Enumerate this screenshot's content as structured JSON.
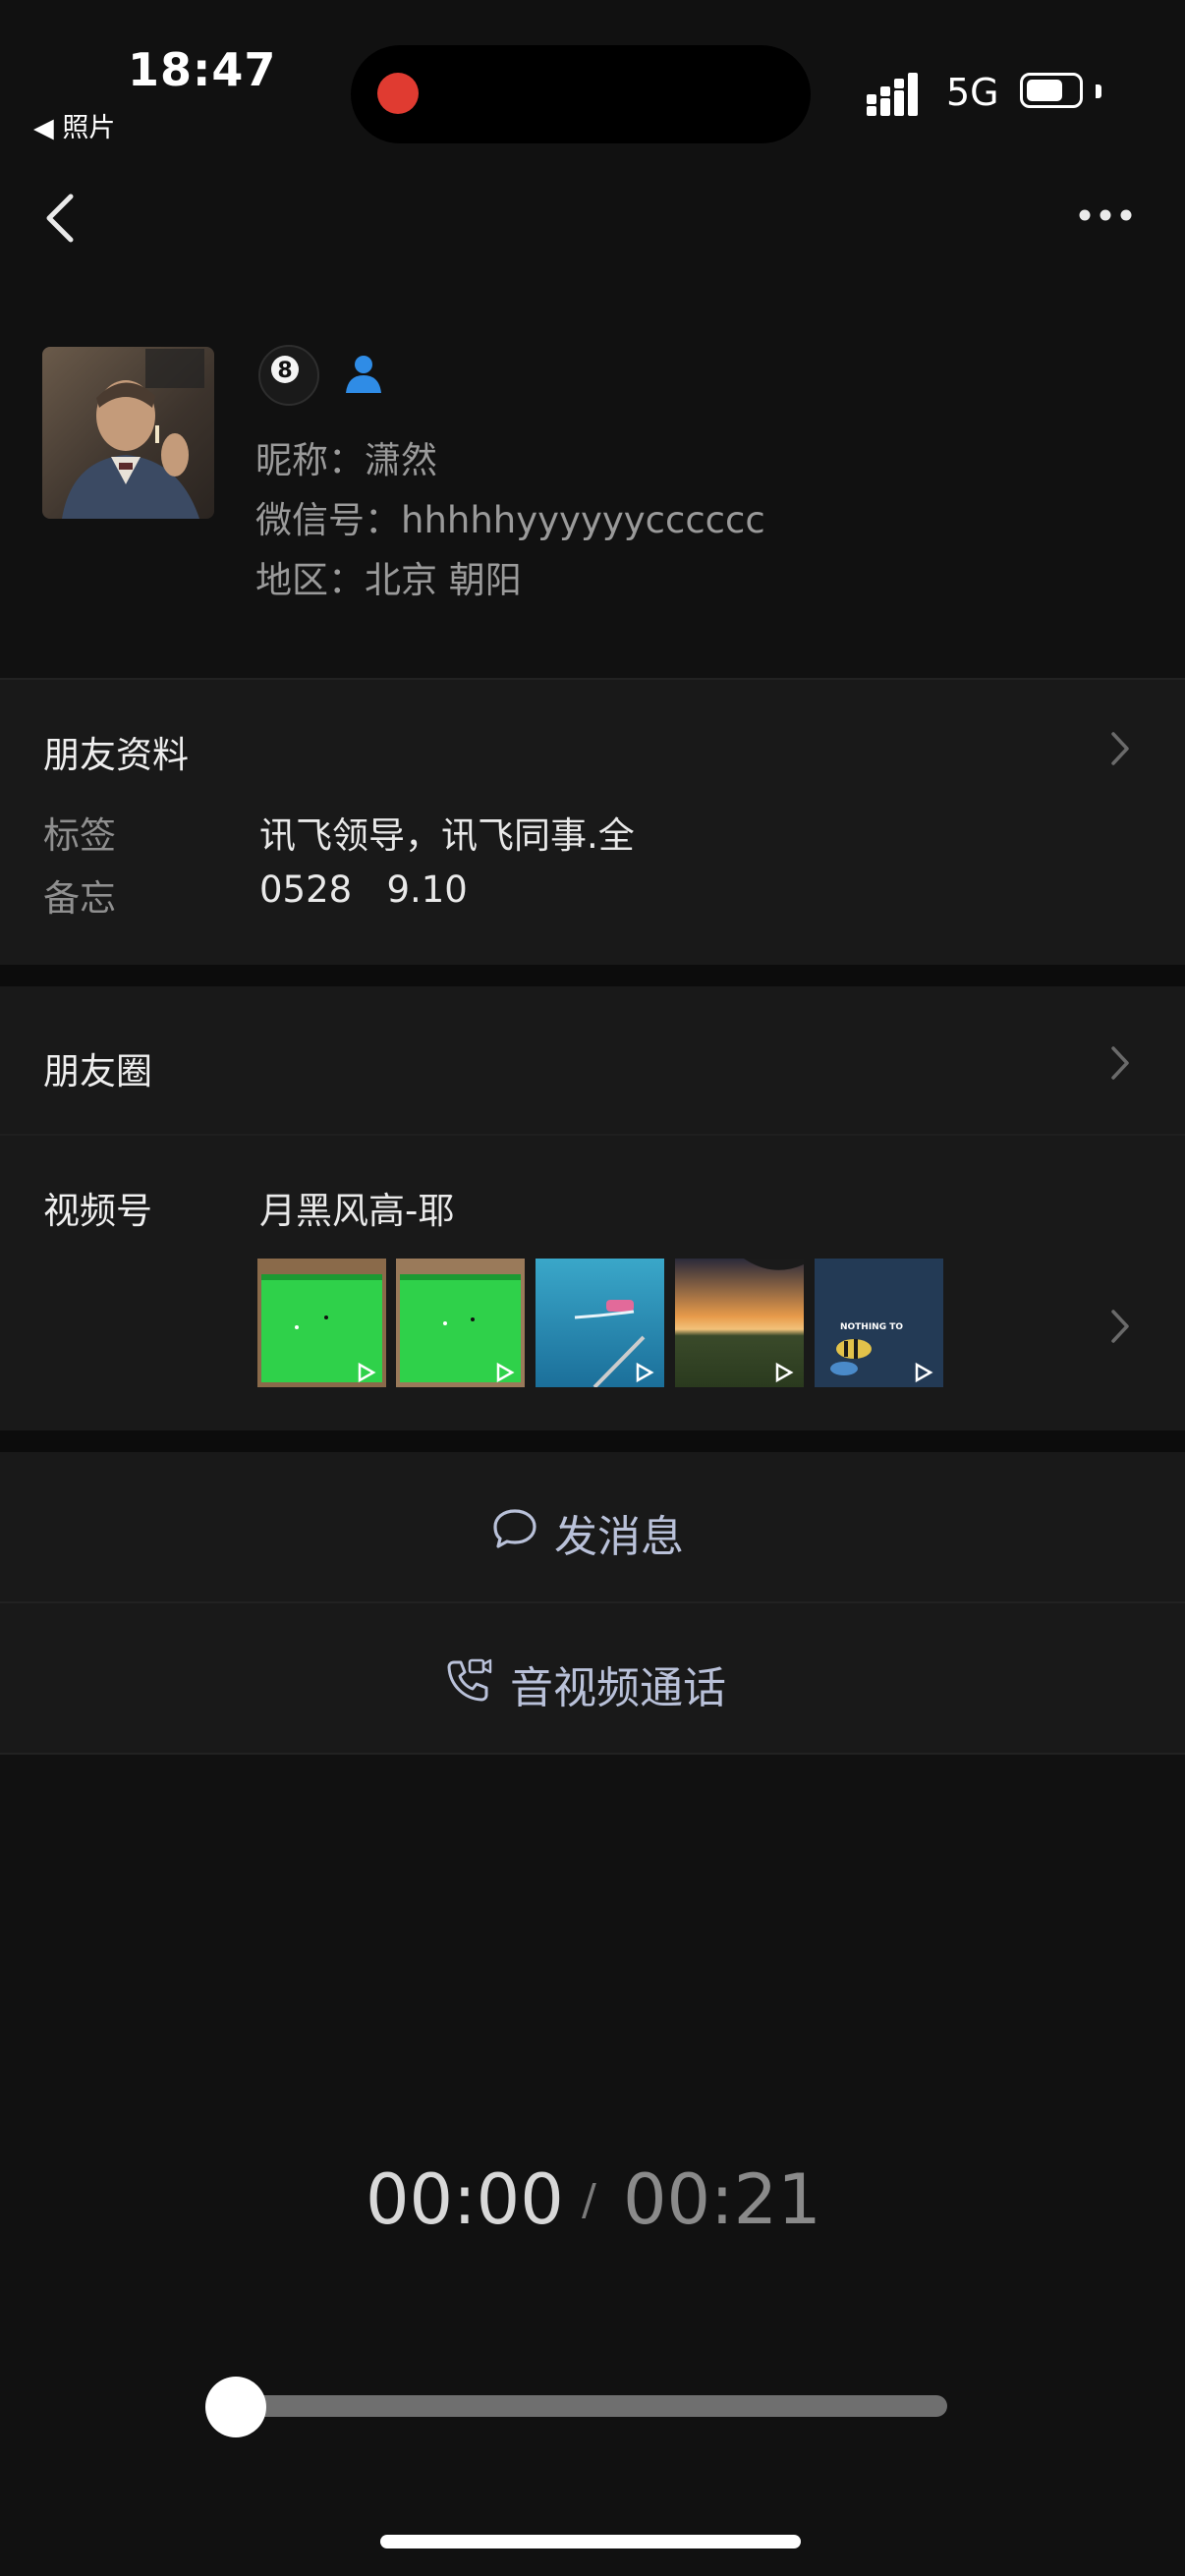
{
  "status_bar": {
    "time": "18:47",
    "back_app": "照片",
    "network": "5G"
  },
  "nav": {
    "back_icon": "chevron-left-icon",
    "more_icon": "more-dots-icon"
  },
  "profile": {
    "nickname": "昵称：潇然",
    "wechat_id": "微信号：hhhhhyyyyyycccccc",
    "region": "地区：北京 朝阳"
  },
  "friend_info": {
    "title": "朋友资料",
    "tags_label": "标签",
    "tags_value": "讯飞领导，讯飞同事.全",
    "remark_label": "备忘",
    "remark_value": "0528   9.10"
  },
  "moments": {
    "title": "朋友圈"
  },
  "channels": {
    "title": "视频号",
    "name": "月黑风高-耶",
    "thumbs": [
      {
        "name": "thumb-snooker-1",
        "kind": "green"
      },
      {
        "name": "thumb-snooker-2",
        "kind": "green"
      },
      {
        "name": "thumb-boat",
        "kind": "sea"
      },
      {
        "name": "thumb-sunset",
        "kind": "sunset"
      },
      {
        "name": "thumb-fish",
        "kind": "fish",
        "caption": "NOTHING TO"
      }
    ]
  },
  "actions": {
    "message": "发消息",
    "call": "音视频通话"
  },
  "player": {
    "current": "00:00",
    "separator": "/",
    "total": "00:21",
    "progress": 0
  },
  "colors": {
    "background": "#111111",
    "record_dot": "#e03b31",
    "action_text": "#b9c1d9",
    "person_badge": "#2f8ce6"
  }
}
